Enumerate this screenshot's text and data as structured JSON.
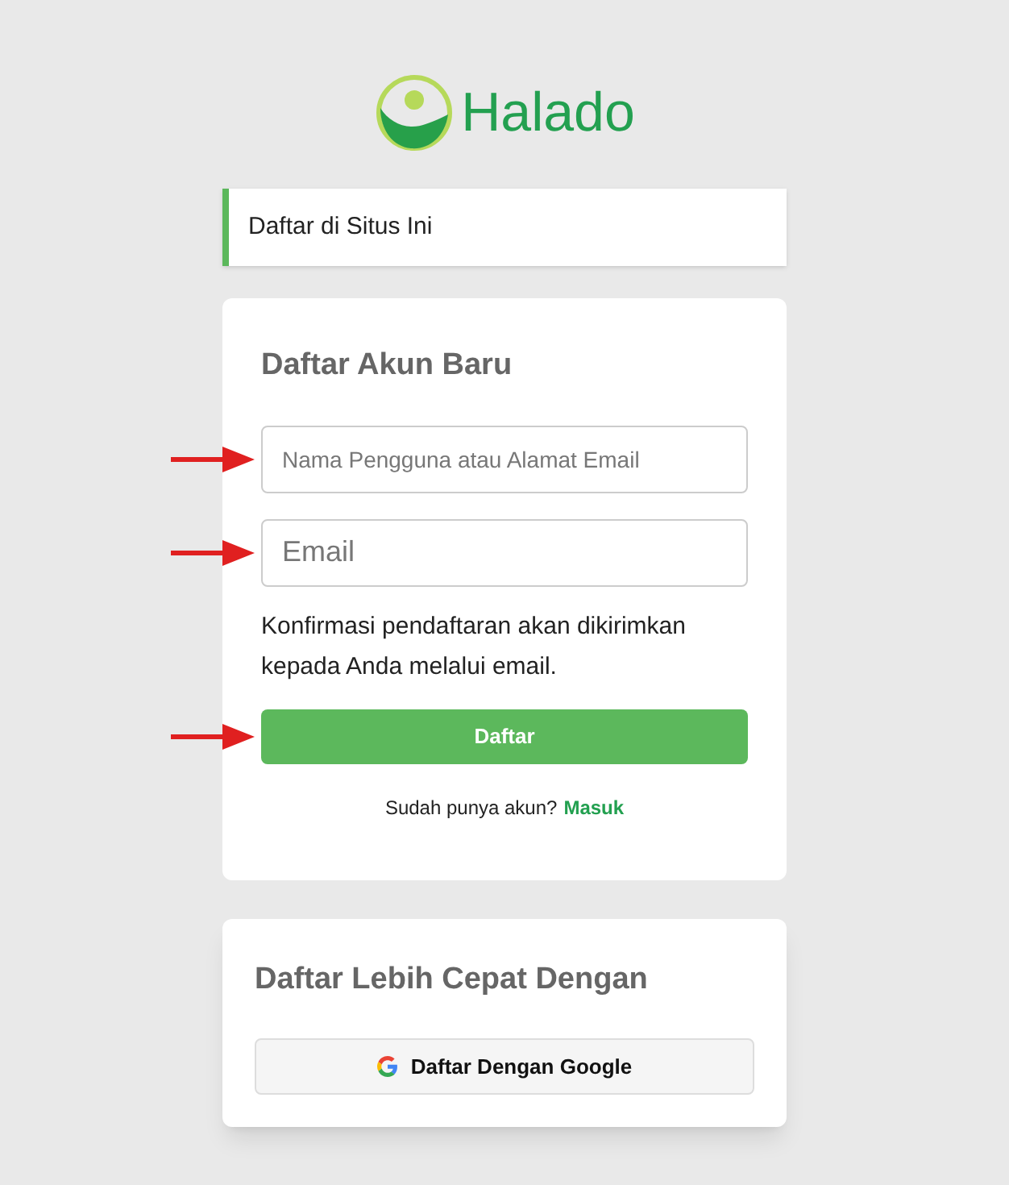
{
  "logo": {
    "text": "Halado"
  },
  "notice": {
    "text": "Daftar di Situs Ini"
  },
  "register": {
    "title": "Daftar Akun Baru",
    "fields": [
      {
        "placeholder": "Nama Pengguna atau Alamat Email",
        "kind": "small"
      },
      {
        "placeholder": "Email",
        "kind": "large"
      }
    ],
    "note": "Konfirmasi pendaftaran akan dikirimkan kepada Anda melalui email.",
    "submit": "Daftar",
    "login_prompt": "Sudah punya akun?",
    "login_link": "Masuk"
  },
  "social": {
    "title": "Daftar Lebih Cepat Dengan",
    "button": "Daftar Dengan Google"
  }
}
